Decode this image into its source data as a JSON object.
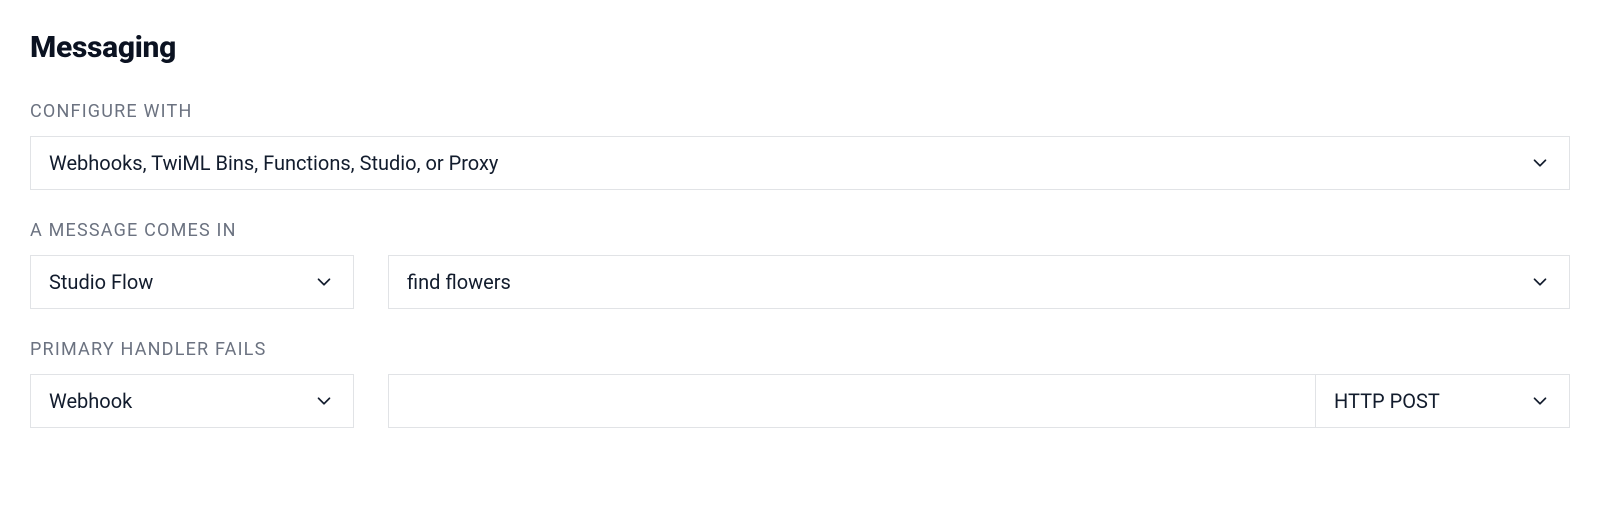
{
  "section": {
    "title": "Messaging"
  },
  "configure": {
    "label": "CONFIGURE WITH",
    "selected": "Webhooks, TwiML Bins, Functions, Studio, or Proxy"
  },
  "incoming": {
    "label": "A MESSAGE COMES IN",
    "type_selected": "Studio Flow",
    "value_selected": "find flowers"
  },
  "fallback": {
    "label": "PRIMARY HANDLER FAILS",
    "type_selected": "Webhook",
    "url_value": "",
    "method_selected": "HTTP POST"
  }
}
